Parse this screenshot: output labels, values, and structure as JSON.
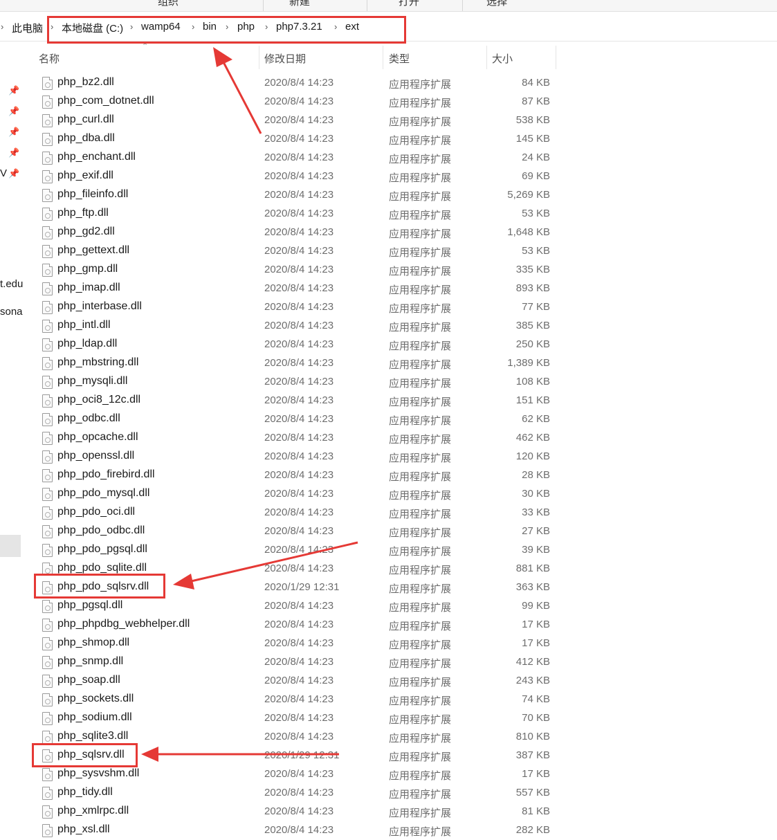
{
  "ribbon": {
    "items": [
      "组织",
      "新建",
      "打开",
      "选择"
    ]
  },
  "address_bar": {
    "crumbs": [
      "此电脑",
      "本地磁盘 (C:)",
      "wamp64",
      "bin",
      "php",
      "php7.3.21",
      "ext"
    ]
  },
  "nav_pane": {
    "snippet1": "V",
    "snippet2": "t.edu",
    "snippet3": "sona"
  },
  "columns": {
    "name": "名称",
    "date": "修改日期",
    "type": "类型",
    "size": "大小"
  },
  "files": [
    {
      "name": "php_bz2.dll",
      "date": "2020/8/4 14:23",
      "type": "应用程序扩展",
      "size": "84 KB"
    },
    {
      "name": "php_com_dotnet.dll",
      "date": "2020/8/4 14:23",
      "type": "应用程序扩展",
      "size": "87 KB"
    },
    {
      "name": "php_curl.dll",
      "date": "2020/8/4 14:23",
      "type": "应用程序扩展",
      "size": "538 KB"
    },
    {
      "name": "php_dba.dll",
      "date": "2020/8/4 14:23",
      "type": "应用程序扩展",
      "size": "145 KB"
    },
    {
      "name": "php_enchant.dll",
      "date": "2020/8/4 14:23",
      "type": "应用程序扩展",
      "size": "24 KB"
    },
    {
      "name": "php_exif.dll",
      "date": "2020/8/4 14:23",
      "type": "应用程序扩展",
      "size": "69 KB"
    },
    {
      "name": "php_fileinfo.dll",
      "date": "2020/8/4 14:23",
      "type": "应用程序扩展",
      "size": "5,269 KB"
    },
    {
      "name": "php_ftp.dll",
      "date": "2020/8/4 14:23",
      "type": "应用程序扩展",
      "size": "53 KB"
    },
    {
      "name": "php_gd2.dll",
      "date": "2020/8/4 14:23",
      "type": "应用程序扩展",
      "size": "1,648 KB"
    },
    {
      "name": "php_gettext.dll",
      "date": "2020/8/4 14:23",
      "type": "应用程序扩展",
      "size": "53 KB"
    },
    {
      "name": "php_gmp.dll",
      "date": "2020/8/4 14:23",
      "type": "应用程序扩展",
      "size": "335 KB"
    },
    {
      "name": "php_imap.dll",
      "date": "2020/8/4 14:23",
      "type": "应用程序扩展",
      "size": "893 KB"
    },
    {
      "name": "php_interbase.dll",
      "date": "2020/8/4 14:23",
      "type": "应用程序扩展",
      "size": "77 KB"
    },
    {
      "name": "php_intl.dll",
      "date": "2020/8/4 14:23",
      "type": "应用程序扩展",
      "size": "385 KB"
    },
    {
      "name": "php_ldap.dll",
      "date": "2020/8/4 14:23",
      "type": "应用程序扩展",
      "size": "250 KB"
    },
    {
      "name": "php_mbstring.dll",
      "date": "2020/8/4 14:23",
      "type": "应用程序扩展",
      "size": "1,389 KB"
    },
    {
      "name": "php_mysqli.dll",
      "date": "2020/8/4 14:23",
      "type": "应用程序扩展",
      "size": "108 KB"
    },
    {
      "name": "php_oci8_12c.dll",
      "date": "2020/8/4 14:23",
      "type": "应用程序扩展",
      "size": "151 KB"
    },
    {
      "name": "php_odbc.dll",
      "date": "2020/8/4 14:23",
      "type": "应用程序扩展",
      "size": "62 KB"
    },
    {
      "name": "php_opcache.dll",
      "date": "2020/8/4 14:23",
      "type": "应用程序扩展",
      "size": "462 KB"
    },
    {
      "name": "php_openssl.dll",
      "date": "2020/8/4 14:23",
      "type": "应用程序扩展",
      "size": "120 KB"
    },
    {
      "name": "php_pdo_firebird.dll",
      "date": "2020/8/4 14:23",
      "type": "应用程序扩展",
      "size": "28 KB"
    },
    {
      "name": "php_pdo_mysql.dll",
      "date": "2020/8/4 14:23",
      "type": "应用程序扩展",
      "size": "30 KB"
    },
    {
      "name": "php_pdo_oci.dll",
      "date": "2020/8/4 14:23",
      "type": "应用程序扩展",
      "size": "33 KB"
    },
    {
      "name": "php_pdo_odbc.dll",
      "date": "2020/8/4 14:23",
      "type": "应用程序扩展",
      "size": "27 KB"
    },
    {
      "name": "php_pdo_pgsql.dll",
      "date": "2020/8/4 14:23",
      "type": "应用程序扩展",
      "size": "39 KB"
    },
    {
      "name": "php_pdo_sqlite.dll",
      "date": "2020/8/4 14:23",
      "type": "应用程序扩展",
      "size": "881 KB"
    },
    {
      "name": "php_pdo_sqlsrv.dll",
      "date": "2020/1/29 12:31",
      "type": "应用程序扩展",
      "size": "363 KB"
    },
    {
      "name": "php_pgsql.dll",
      "date": "2020/8/4 14:23",
      "type": "应用程序扩展",
      "size": "99 KB"
    },
    {
      "name": "php_phpdbg_webhelper.dll",
      "date": "2020/8/4 14:23",
      "type": "应用程序扩展",
      "size": "17 KB"
    },
    {
      "name": "php_shmop.dll",
      "date": "2020/8/4 14:23",
      "type": "应用程序扩展",
      "size": "17 KB"
    },
    {
      "name": "php_snmp.dll",
      "date": "2020/8/4 14:23",
      "type": "应用程序扩展",
      "size": "412 KB"
    },
    {
      "name": "php_soap.dll",
      "date": "2020/8/4 14:23",
      "type": "应用程序扩展",
      "size": "243 KB"
    },
    {
      "name": "php_sockets.dll",
      "date": "2020/8/4 14:23",
      "type": "应用程序扩展",
      "size": "74 KB"
    },
    {
      "name": "php_sodium.dll",
      "date": "2020/8/4 14:23",
      "type": "应用程序扩展",
      "size": "70 KB"
    },
    {
      "name": "php_sqlite3.dll",
      "date": "2020/8/4 14:23",
      "type": "应用程序扩展",
      "size": "810 KB"
    },
    {
      "name": "php_sqlsrv.dll",
      "date": "2020/1/29 12:31",
      "type": "应用程序扩展",
      "size": "387 KB"
    },
    {
      "name": "php_sysvshm.dll",
      "date": "2020/8/4 14:23",
      "type": "应用程序扩展",
      "size": "17 KB"
    },
    {
      "name": "php_tidy.dll",
      "date": "2020/8/4 14:23",
      "type": "应用程序扩展",
      "size": "557 KB"
    },
    {
      "name": "php_xmlrpc.dll",
      "date": "2020/8/4 14:23",
      "type": "应用程序扩展",
      "size": "81 KB"
    },
    {
      "name": "php_xsl.dll",
      "date": "2020/8/4 14:23",
      "type": "应用程序扩展",
      "size": "282 KB"
    }
  ],
  "colors": {
    "annotation": "#e53935",
    "nav_selected": "#e5e5e5",
    "text_secondary": "#6d6d6d"
  },
  "icons": {
    "file": "dll-file-icon",
    "pin": "pin-icon",
    "chevron": "chevron-right-icon"
  }
}
